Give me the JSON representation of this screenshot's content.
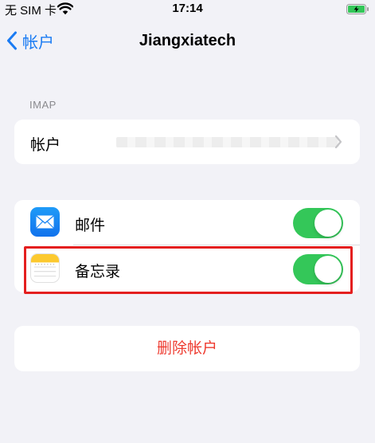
{
  "status_bar": {
    "carrier": "无 SIM 卡",
    "time": "17:14",
    "wifi_icon": "wifi-icon",
    "battery_icon": "battery-charging-icon",
    "battery_color": "#34c759"
  },
  "nav": {
    "back_label": "帐户",
    "title": "Jiangxiatech",
    "accent_color": "#1a7bf3"
  },
  "imap_section": {
    "header": "IMAP",
    "account_row": {
      "label": "帐户",
      "value": ""
    }
  },
  "apps_section": {
    "items": [
      {
        "label": "邮件",
        "icon": "mail-icon",
        "enabled": true
      },
      {
        "label": "备忘录",
        "icon": "notes-icon",
        "enabled": true
      }
    ],
    "toggle_on_color": "#34c759"
  },
  "delete": {
    "label": "删除帐户",
    "color": "#ee3b30"
  }
}
